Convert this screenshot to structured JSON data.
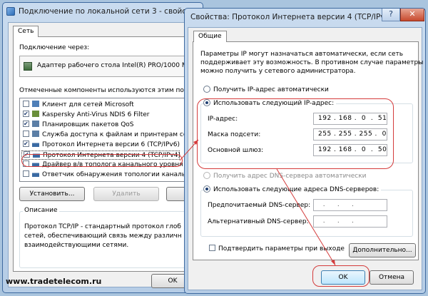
{
  "back_window": {
    "title": "Подключение по локальной сети 3 - свойства",
    "tab": "Сеть",
    "connect_via_label": "Подключение через:",
    "adapter_name": "Адаптер рабочего стола Intel(R) PRO/1000 M",
    "components_label": "Отмеченные компоненты используются этим под",
    "components": [
      {
        "label": "Клиент для сетей Microsoft",
        "checked": false
      },
      {
        "label": "Kaspersky Anti-Virus NDIS 6 Filter",
        "checked": true
      },
      {
        "label": "Планировщик пакетов QoS",
        "checked": true
      },
      {
        "label": "Служба доступа к файлам и принтерам сет",
        "checked": false
      },
      {
        "label": "Протокол Интернета версии 6 (TCP/IPv6)",
        "checked": true
      },
      {
        "label": "Протокол Интернета версии 4 (TCP/IPv4)",
        "checked": true
      },
      {
        "label": "Драйвер в/в тополога канального уровня",
        "checked": false
      },
      {
        "label": "Ответчик обнаружения топологии канальн",
        "checked": false
      }
    ],
    "install_button": "Установить...",
    "remove_button": "Удалить",
    "description_title": "Описание",
    "description_text": [
      "Протокол TCP/IP - стандартный протокол глоб",
      "сетей, обеспечивающий связь между различн",
      "взаимодействующими сетями."
    ],
    "ok_button": "OK"
  },
  "front_window": {
    "title": "Свойства: Протокол Интернета версии 4 (TCP/IPv4)",
    "help_glyph": "?",
    "close_glyph": "✕",
    "tab": "Общие",
    "intro_text": [
      "Параметры IP могут назначаться автоматически, если сеть",
      "поддерживает эту возможность. В противном случае параметры IP",
      "можно получить у сетевого администратора."
    ],
    "ip_auto_label": "Получить IP-адрес автоматически",
    "ip_manual_label": "Использовать следующий IP-адрес:",
    "ip_label": "IP-адрес:",
    "ip_value": "192 . 168 .  0  .  51",
    "mask_label": "Маска подсети:",
    "mask_value": "255 . 255 . 255 .  0",
    "gateway_label": "Основной шлюз:",
    "gateway_value": "192 . 168 .  0  .  50",
    "dns_auto_label": "Получить адрес DNS-сервера автоматически",
    "dns_manual_label": "Использовать следующие адреса DNS-серверов:",
    "dns_preferred_label": "Предпочитаемый DNS-сервер:",
    "dns_preferred_value": "  .     .     .",
    "dns_alternate_label": "Альтернативный DNS-сервер:",
    "dns_alternate_value": "  .     .     .",
    "validate_label": "Подтвердить параметры при выходе",
    "advanced_button": "Дополнительно...",
    "ok_button": "OK",
    "cancel_button": "Отмена"
  },
  "watermark": "www.tradetelecom.ru",
  "colors": {
    "annotation": "#d43c3c",
    "titlebar": "#c9dbef"
  }
}
